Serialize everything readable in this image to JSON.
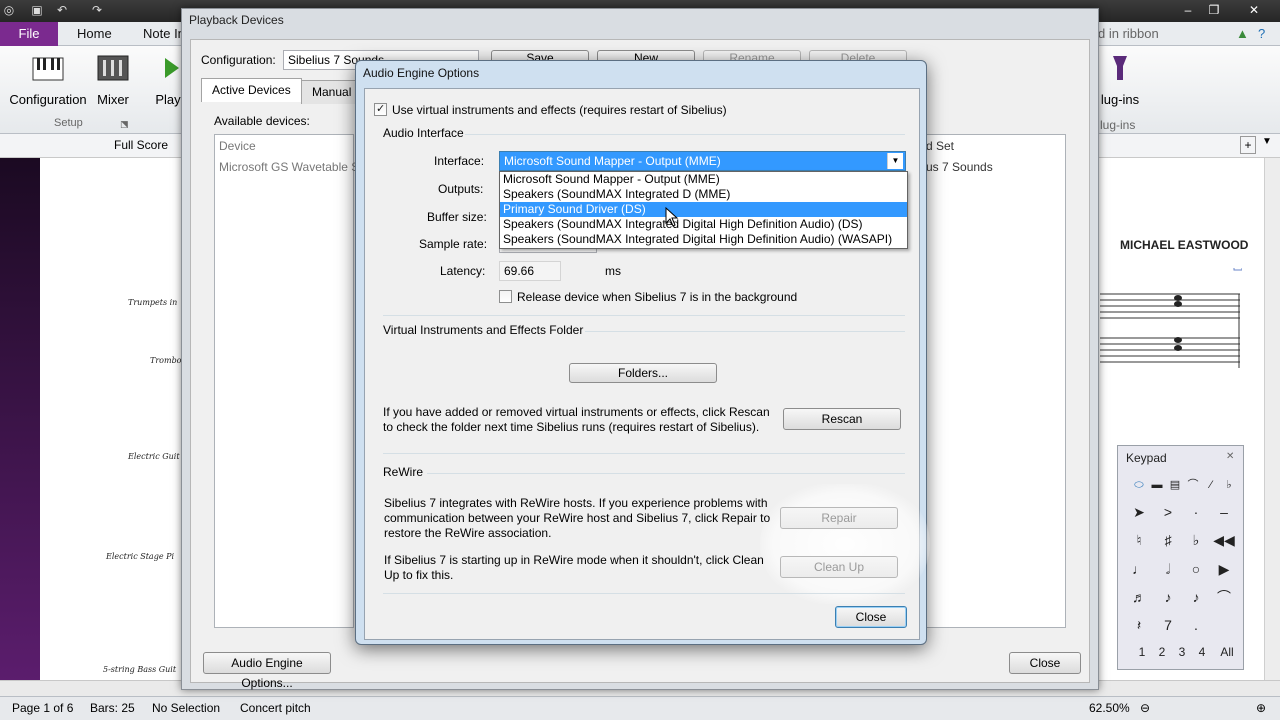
{
  "app": {
    "tabs": [
      "File",
      "Home",
      "Note Input"
    ],
    "ribbon_search_hint": "d in ribbon",
    "ribbon_buttons": {
      "configuration": "Configuration",
      "mixer": "Mixer",
      "play": "Play",
      "plugins": "lug-ins"
    },
    "ribbon_group_setup": "Setup",
    "ribbon_group_plugins": "lug-ins",
    "view_label": "Full Score"
  },
  "score": {
    "composer": "MICHAEL EASTWOOD",
    "instruments": [
      "Trumpets in",
      "Trombon",
      "Electric Guit",
      "Electric Stage Pi",
      "5-string Bass Guit"
    ]
  },
  "status": {
    "page": "Page 1 of 6",
    "bars": "Bars: 25",
    "selection": "No Selection",
    "pitch": "Concert pitch",
    "zoom": "62.50%"
  },
  "playback": {
    "title": "Playback Devices",
    "config_label": "Configuration:",
    "config_value": "Sibelius 7 Sounds",
    "buttons": {
      "save": "Save",
      "new": "New",
      "rename": "Rename",
      "delete": "Delete"
    },
    "tabs": [
      "Active Devices",
      "Manual"
    ],
    "available_label": "Available devices:",
    "device_header": "Device",
    "device_item": "Microsoft GS Wavetable Sy",
    "soundset_header": "d Set",
    "soundset_item": "us 7 Sounds",
    "audio_engine_button": "Audio Engine Options...",
    "close_button": "Close"
  },
  "dialog": {
    "title": "Audio Engine Options",
    "use_virtual_checkbox": "Use virtual instruments and effects (requires restart of Sibelius)",
    "audio_interface_heading": "Audio Interface",
    "interface_label": "Interface:",
    "interface_value": "Microsoft Sound Mapper - Output (MME)",
    "interface_options": [
      "Microsoft Sound Mapper - Output (MME)",
      "Speakers (SoundMAX Integrated D (MME)",
      "Primary Sound Driver (DS)",
      "Speakers (SoundMAX Integrated Digital High Definition Audio) (DS)",
      "Speakers (SoundMAX Integrated Digital High Definition Audio) (WASAPI)"
    ],
    "interface_selected_index": 2,
    "outputs_label": "Outputs:",
    "buffer_label": "Buffer size:",
    "sample_rate_label": "Sample rate:",
    "latency_label": "Latency:",
    "latency_value": "69.66",
    "latency_unit": "ms",
    "release_checkbox": "Release device when Sibelius 7 is in the background",
    "vi_heading": "Virtual Instruments and Effects Folder",
    "folders_button": "Folders...",
    "rescan_text": "If you have added or removed virtual instruments or effects, click Rescan to check the folder next time Sibelius runs (requires restart of Sibelius).",
    "rescan_button": "Rescan",
    "rewire_heading": "ReWire",
    "rewire_text": "Sibelius 7 integrates with ReWire hosts. If you experience problems with communication between your ReWire host and Sibelius 7, click Repair to restore the ReWire association.",
    "repair_button": "Repair",
    "cleanup_text": "If Sibelius 7 is starting up in ReWire mode when it shouldn't, click Clean Up to fix this.",
    "cleanup_button": "Clean Up",
    "close_button": "Close"
  },
  "keypad": {
    "title": "Keypad",
    "layouts": [
      "1",
      "2",
      "3",
      "4",
      "All"
    ]
  }
}
